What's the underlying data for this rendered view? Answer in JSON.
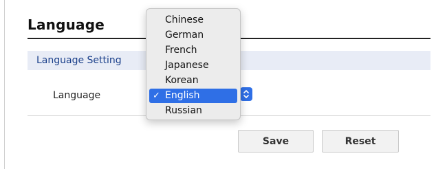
{
  "page": {
    "title": "Language"
  },
  "section": {
    "label": "Language Setting"
  },
  "form": {
    "language_label": "Language"
  },
  "dropdown": {
    "options": [
      {
        "label": "Chinese"
      },
      {
        "label": "German"
      },
      {
        "label": "French"
      },
      {
        "label": "Japanese"
      },
      {
        "label": "Korean"
      },
      {
        "label": "English",
        "selected": true
      },
      {
        "label": "Russian"
      }
    ],
    "check_glyph": "✓",
    "selected_value": "English"
  },
  "buttons": {
    "save_label": "Save",
    "reset_label": "Reset"
  },
  "colors": {
    "section_bar_bg": "#e8ecf6",
    "section_bar_text": "#1a3f8a",
    "selection_accent": "#2f6fe6"
  },
  "icons": {
    "select_toggle": "chevron-up-down-icon",
    "check": "check-icon"
  }
}
